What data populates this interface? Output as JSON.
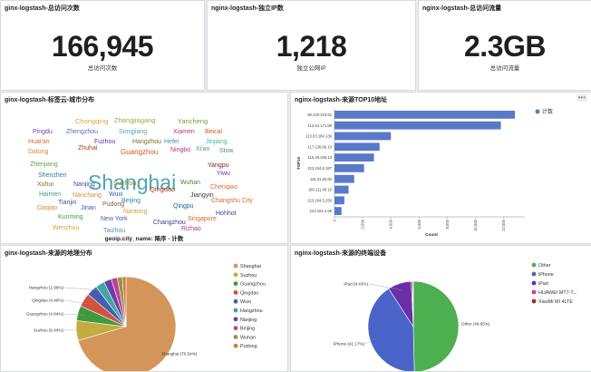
{
  "panels": {
    "total_visits": {
      "title": "ginx-logstash-总访问次数",
      "value": "166,945",
      "label": "总访问次数"
    },
    "unique_ip": {
      "title": "nginx-logstash-独立IP数",
      "value": "1,218",
      "label": "独立公网IP"
    },
    "total_traffic": {
      "title": "nginx-logstash-总访问流量",
      "value": "2.3GB",
      "label": "总访问流量"
    },
    "word_cloud": {
      "title": "ginx-logstash-标签云-城市分布",
      "caption": "geoip.city_name: 降序 - 计数",
      "words": [
        {
          "text": "Chongqing",
          "color": "#d6a93d"
        },
        {
          "text": "Zhangjiagang",
          "color": "#8bb53c"
        },
        {
          "text": "Yancheng",
          "color": "#6fa33b"
        },
        {
          "text": "Pingdu",
          "color": "#6a3fb0"
        },
        {
          "text": "Zhengzhou",
          "color": "#5a6fb8"
        },
        {
          "text": "Songjiang",
          "color": "#5aa4a4"
        },
        {
          "text": "Xiamen",
          "color": "#b0367a"
        },
        {
          "text": "Beicai",
          "color": "#c85a2a"
        },
        {
          "text": "Huai'an",
          "color": "#d86a2c"
        },
        {
          "text": "Fuzhou",
          "color": "#5a3a9e"
        },
        {
          "text": "Hangzhou",
          "color": "#7a6b2a"
        },
        {
          "text": "Hefei",
          "color": "#3f8fb8"
        },
        {
          "text": "Jinjiang",
          "color": "#4fb29d"
        },
        {
          "text": "Datong",
          "color": "#d88a3a"
        },
        {
          "text": "Zhuhai",
          "color": "#b23a1e"
        },
        {
          "text": "Guangzhou",
          "color": "#cd5a1e"
        },
        {
          "text": "Ningbo",
          "color": "#b0367a"
        },
        {
          "text": "Xi'an",
          "color": "#3aa46e"
        },
        {
          "text": "Stow",
          "color": "#4a8f9a"
        },
        {
          "text": "Zhenjiang",
          "color": "#5aa43a"
        },
        {
          "text": "Shanghai",
          "color": "#4fa5b0"
        },
        {
          "text": "Yangpu",
          "color": "#8b1e1e"
        },
        {
          "text": "Shenzhen",
          "color": "#2d7aa8"
        },
        {
          "text": "Yiwu",
          "color": "#5a3a9e"
        },
        {
          "text": "Xuhui",
          "color": "#7a6b2a"
        },
        {
          "text": "Nanjing",
          "color": "#3a4ca8"
        },
        {
          "text": "Suzhou",
          "color": "#8a8a3a"
        },
        {
          "text": "Wuhan",
          "color": "#3a8a3a"
        },
        {
          "text": "Haimen",
          "color": "#3a9a7a"
        },
        {
          "text": "Nanchang",
          "color": "#d88a3a"
        },
        {
          "text": "Wuxi",
          "color": "#2d5aa8"
        },
        {
          "text": "Qingdao",
          "color": "#b23a1e"
        },
        {
          "text": "Chenqiao",
          "color": "#d86a2c"
        },
        {
          "text": "Tianjin",
          "color": "#3a4ca8"
        },
        {
          "text": "Beijing",
          "color": "#2d8aa8"
        },
        {
          "text": "Jiangyin",
          "color": "#3a3a3a"
        },
        {
          "text": "Daqiao",
          "color": "#d88a3a"
        },
        {
          "text": "Jinan",
          "color": "#3a5aa8"
        },
        {
          "text": "Pudong",
          "color": "#8a5a3a"
        },
        {
          "text": "Qingpu",
          "color": "#1e6a8a"
        },
        {
          "text": "Changshu City",
          "color": "#d86a2c"
        },
        {
          "text": "Kunming",
          "color": "#3aa44a"
        },
        {
          "text": "Nantong",
          "color": "#d8a03a"
        },
        {
          "text": "Hohhot",
          "color": "#2d4aa8"
        },
        {
          "text": "New York",
          "color": "#4a5ab8"
        },
        {
          "text": "Changzhou",
          "color": "#3a3a8a"
        },
        {
          "text": "Singapore",
          "color": "#d86a2c"
        },
        {
          "text": "Wenzhou",
          "color": "#d8a03a"
        },
        {
          "text": "Taizhou",
          "color": "#5a8ab8"
        },
        {
          "text": "Rizhao",
          "color": "#b0367a"
        }
      ]
    },
    "top10": {
      "title": "nginx-logstash-来源TOP10地址",
      "legend": "计数",
      "ylabel": "TOP10",
      "xlabel": "Count",
      "color": "#5b79c9"
    },
    "geo_pie": {
      "title": "ginx-logstash-来源的地理分布",
      "legend": [
        {
          "name": "Shanghai",
          "color": "#d4955a"
        },
        {
          "name": "Suzhou",
          "color": "#c4ad3f"
        },
        {
          "name": "Guangzhou",
          "color": "#3f9a3f"
        },
        {
          "name": "Qingdao",
          "color": "#d4503f"
        },
        {
          "name": "Wuxi",
          "color": "#3f5fb4"
        },
        {
          "name": "Hangzhou",
          "color": "#3fa8a0"
        },
        {
          "name": "Nanjing",
          "color": "#6a3fa8"
        },
        {
          "name": "Beijing",
          "color": "#c43f9a"
        },
        {
          "name": "Wuhan",
          "color": "#8a9a3f"
        },
        {
          "name": "Pudong",
          "color": "#d47a3f"
        }
      ],
      "labels": {
        "hangzhou": "Hangzhou (2.96%)",
        "qingdao": "Qingdao (4.46%)",
        "guangzhou": "Guangzhou (4.84%)",
        "suzhou": "Suzhou (6.44%)",
        "shanghai": "Shanghai (70.54%)"
      }
    },
    "device_pie": {
      "title": "nginx-logstash-来源的终端设备",
      "legend": [
        {
          "name": "Other",
          "color": "#4caf50"
        },
        {
          "name": "iPhone",
          "color": "#4a63c8"
        },
        {
          "name": "iPad",
          "color": "#6a2fa8"
        },
        {
          "name": "HUAWEI MT7-T...",
          "color": "#c43f9a"
        },
        {
          "name": "XiaoMi MI 4LTE",
          "color": "#b42020"
        }
      ],
      "labels": {
        "ipad": "iPad (8.43%)",
        "other": "Other (49.65%)",
        "iphone": "iPhone (41.17%)"
      }
    }
  },
  "chart_data": [
    {
      "type": "bar",
      "orientation": "horizontal",
      "title": "nginx-logstash-来源TOP10地址",
      "xlabel": "Count",
      "ylabel": "TOP10",
      "categories": [
        "58.220.223.62",
        "112.64.171.69",
        "113.63.184.139",
        "117.136.66.10",
        "115.29.245.13",
        "223.104.6.187",
        "116.21.60.60",
        "180.111.48.15",
        "223.104.5.250",
        "223.104.4.59"
      ],
      "series": [
        {
          "name": "计数",
          "values": [
            12800,
            11800,
            4000,
            3200,
            2800,
            2100,
            1400,
            1000,
            700,
            500
          ]
        }
      ],
      "xticks": [
        "0",
        "2,000",
        "4,000",
        "6,000",
        "8,000",
        "10,000",
        "12,000"
      ],
      "xlim": [
        0,
        13500
      ]
    },
    {
      "type": "pie",
      "title": "ginx-logstash-来源的地理分布",
      "categories": [
        "Shanghai",
        "Suzhou",
        "Guangzhou",
        "Qingdao",
        "Wuxi",
        "Hangzhou",
        "Nanjing",
        "Beijing",
        "Wuhan",
        "Pudong"
      ],
      "values": [
        70.54,
        6.44,
        4.84,
        4.46,
        3.5,
        2.96,
        2.5,
        2.0,
        1.6,
        1.2
      ]
    },
    {
      "type": "pie",
      "title": "nginx-logstash-来源的终端设备",
      "categories": [
        "Other",
        "iPhone",
        "iPad",
        "HUAWEI MT7-T...",
        "XiaoMi MI 4LTE"
      ],
      "values": [
        49.65,
        41.17,
        8.43,
        0.5,
        0.25
      ]
    }
  ]
}
